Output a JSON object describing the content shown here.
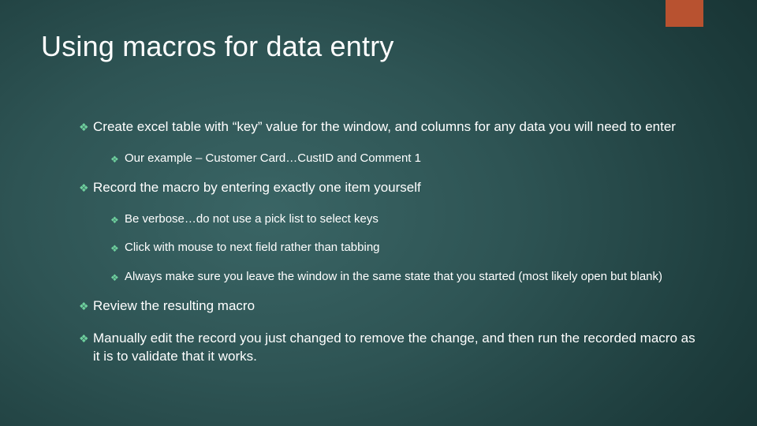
{
  "slide": {
    "title": "Using macros for data entry",
    "bullets": {
      "b1": "Create excel table with “key” value for the window, and columns for any data you will need to enter",
      "b1_1": "Our example – Customer Card…CustID and Comment 1",
      "b2": "Record the macro by entering exactly one item yourself",
      "b2_1": "Be verbose…do not use a pick list to select keys",
      "b2_2": "Click with mouse to next field rather than tabbing",
      "b2_3": "Always make sure you leave the window in the same state that you started (most likely open but blank)",
      "b3": "Review the resulting macro",
      "b4": "Manually edit the record you just changed to remove the change, and then run the recorded macro as it is to validate that it works."
    }
  },
  "glyphs": {
    "diamond": "❖"
  }
}
